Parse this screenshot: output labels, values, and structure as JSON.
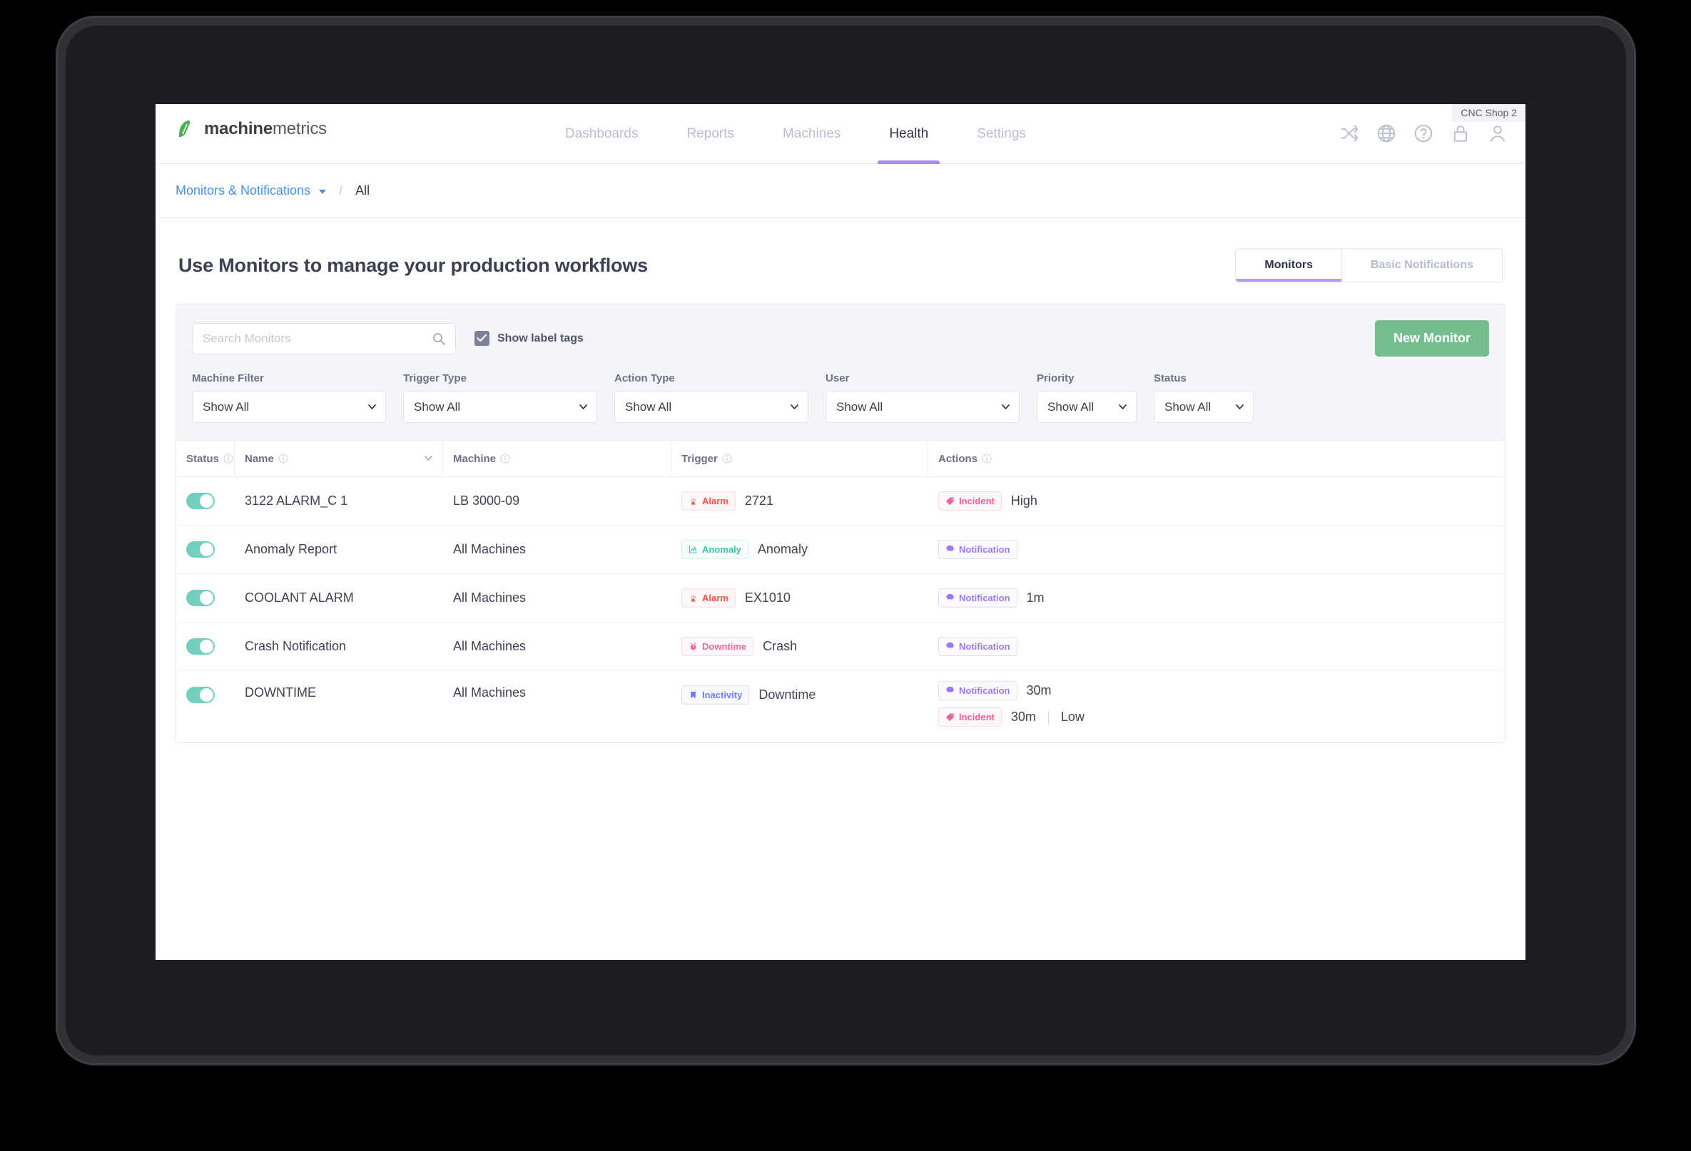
{
  "nav": {
    "brand_strong": "machine",
    "brand_light": "metrics",
    "tabs": [
      {
        "label": "Dashboards",
        "active": false
      },
      {
        "label": "Reports",
        "active": false
      },
      {
        "label": "Machines",
        "active": false
      },
      {
        "label": "Health",
        "active": true
      },
      {
        "label": "Settings",
        "active": false
      }
    ],
    "account_chip": "CNC Shop 2",
    "icons": [
      "shuffle-icon",
      "globe-icon",
      "help-icon",
      "lock-icon",
      "user-icon"
    ]
  },
  "breadcrumb": {
    "link": "Monitors & Notifications",
    "separator": "/",
    "current": "All"
  },
  "page": {
    "title": "Use Monitors to manage your production workflows",
    "view_switch": [
      {
        "label": "Monitors",
        "active": true
      },
      {
        "label": "Basic Notifications",
        "active": false
      }
    ]
  },
  "toolbar": {
    "search_placeholder": "Search Monitors",
    "search_value": "",
    "show_label_tags": "Show label tags",
    "show_label_tags_checked": true,
    "new_monitor": "New Monitor"
  },
  "filters": [
    {
      "label": "Machine Filter",
      "value": "Show All",
      "width": "wide"
    },
    {
      "label": "Trigger Type",
      "value": "Show All",
      "width": "wide"
    },
    {
      "label": "Action Type",
      "value": "Show All",
      "width": "wide"
    },
    {
      "label": "User",
      "value": "Show All",
      "width": "wide"
    },
    {
      "label": "Priority",
      "value": "Show All",
      "width": "narrow"
    },
    {
      "label": "Status",
      "value": "Show All",
      "width": "narrow"
    }
  ],
  "table": {
    "columns": [
      {
        "label": "Status",
        "info": true,
        "sortable": false
      },
      {
        "label": "Name",
        "info": true,
        "sortable": true
      },
      {
        "label": "Machine",
        "info": true,
        "sortable": false
      },
      {
        "label": "Trigger",
        "info": true,
        "sortable": false
      },
      {
        "label": "Actions",
        "info": true,
        "sortable": false
      }
    ],
    "rows": [
      {
        "enabled": true,
        "name": "3122 ALARM_C 1",
        "machine": "LB 3000-09",
        "trigger": {
          "badge": "Alarm",
          "type": "alarm",
          "value": "2721"
        },
        "actions": [
          {
            "badge": "Incident",
            "type": "incident",
            "meta": [
              "High"
            ]
          }
        ]
      },
      {
        "enabled": true,
        "name": "Anomaly Report",
        "machine": "All Machines",
        "trigger": {
          "badge": "Anomaly",
          "type": "anomaly",
          "value": "Anomaly"
        },
        "actions": [
          {
            "badge": "Notification",
            "type": "notification",
            "meta": []
          }
        ]
      },
      {
        "enabled": true,
        "name": "COOLANT ALARM",
        "machine": "All Machines",
        "trigger": {
          "badge": "Alarm",
          "type": "alarm",
          "value": "EX1010"
        },
        "actions": [
          {
            "badge": "Notification",
            "type": "notification",
            "meta": [
              "1m"
            ]
          }
        ]
      },
      {
        "enabled": true,
        "name": "Crash Notification",
        "machine": "All Machines",
        "trigger": {
          "badge": "Downtime",
          "type": "downtime",
          "value": "Crash"
        },
        "actions": [
          {
            "badge": "Notification",
            "type": "notification",
            "meta": []
          }
        ]
      },
      {
        "enabled": true,
        "name": "DOWNTIME",
        "machine": "All Machines",
        "trigger": {
          "badge": "Inactivity",
          "type": "inactivity",
          "value": "Downtime"
        },
        "actions": [
          {
            "badge": "Notification",
            "type": "notification",
            "meta": [
              "30m"
            ]
          },
          {
            "badge": "Incident",
            "type": "incident",
            "meta": [
              "30m",
              "Low"
            ]
          }
        ]
      }
    ]
  },
  "colors": {
    "brand_green": "#5aa84f",
    "accent_purple": "#a78bf0",
    "button_green": "#74bd8e",
    "toggle_on": "#71cfc0",
    "link_blue": "#4a90e2"
  }
}
